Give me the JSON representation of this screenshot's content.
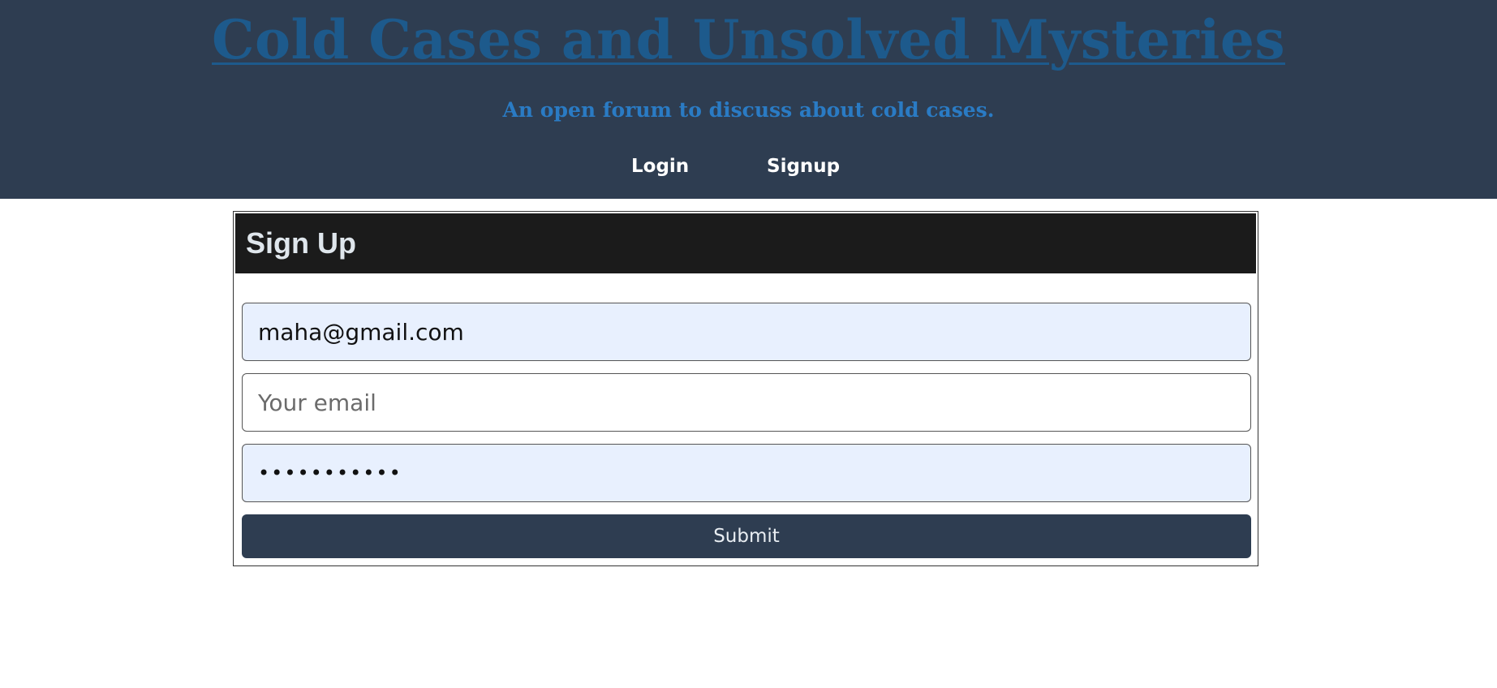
{
  "header": {
    "title": "Cold Cases and Unsolved Mysteries",
    "subtitle": "An open forum to discuss about cold cases.",
    "nav": {
      "login_label": "Login",
      "signup_label": "Signup"
    }
  },
  "signup_form": {
    "heading": "Sign Up",
    "fields": [
      {
        "value": "maha@gmail.com",
        "placeholder": ""
      },
      {
        "value": "",
        "placeholder": "Your email"
      },
      {
        "value": "•••••••••••",
        "placeholder": "",
        "type": "password"
      }
    ],
    "submit_label": "Submit"
  },
  "colors": {
    "header_bg": "#2e3d51",
    "title": "#1d5a8c",
    "subtitle": "#2a7bc4",
    "card_header_bg": "#1b1b1b",
    "autofill_bg": "#e8f0fe",
    "button_bg": "#2e3d51"
  }
}
